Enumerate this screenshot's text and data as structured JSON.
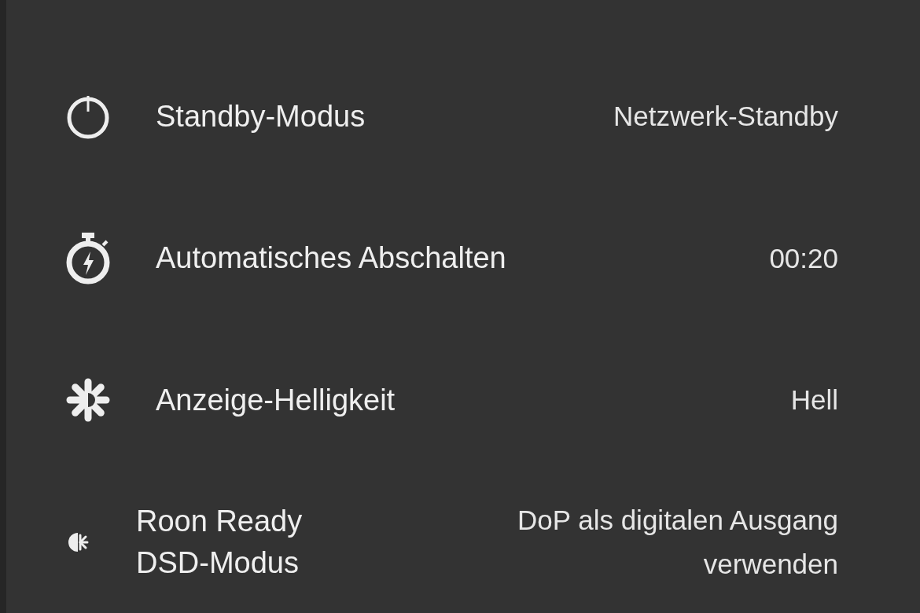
{
  "settings": [
    {
      "kind": "power",
      "label": "Standby-Modus",
      "value": "Netzwerk-Standby"
    },
    {
      "kind": "timer",
      "label": "Automatisches Abschalten",
      "value": "00:20"
    },
    {
      "kind": "brightness",
      "label": "Anzeige-Helligkeit",
      "value": "Hell"
    },
    {
      "kind": "dsd",
      "label": "Roon Ready\nDSD-Modus",
      "value": "DoP als digitalen Ausgang\nverwenden"
    }
  ]
}
